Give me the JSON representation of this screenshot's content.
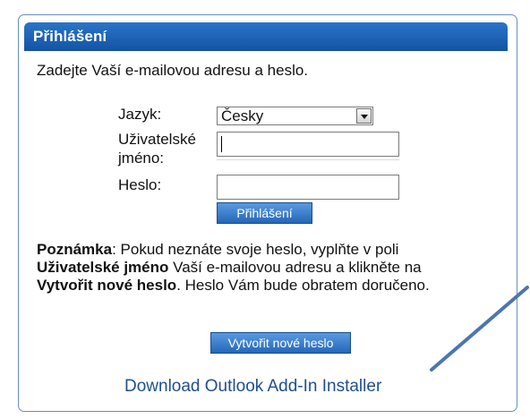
{
  "panel": {
    "title": "Přihlášení",
    "intro": "Zadejte Vaší e-mailovou adresu a heslo."
  },
  "form": {
    "language_label": "Jazyk:",
    "language_value": "Česky",
    "username_label_line1": "Uživatelské",
    "username_label_line2": "jméno:",
    "username_value": "",
    "password_label": "Heslo:",
    "password_value": "",
    "login_button": "Přihlášení"
  },
  "note": {
    "label": "Poznámka",
    "text_1": ": Pokud neznáte svoje heslo, vyplňte v poli",
    "field_name": "Uživatelské jméno",
    "text_2": " Vaší e-mailovou adresu a klikněte na",
    "button_name": "Vytvořit nové heslo",
    "text_3": ". Heslo Vám bude obratem doručeno."
  },
  "actions": {
    "reset_button": "Vytvořit nové heslo",
    "download_link": "Download Outlook Add-In Installer"
  },
  "colors": {
    "header_blue": "#1f66bb",
    "button_blue": "#2f79c9",
    "link_blue": "#1f4f8f",
    "annotation_arrow": "#4c76b0"
  },
  "icons": {
    "dropdown": "chevron-down-icon"
  }
}
